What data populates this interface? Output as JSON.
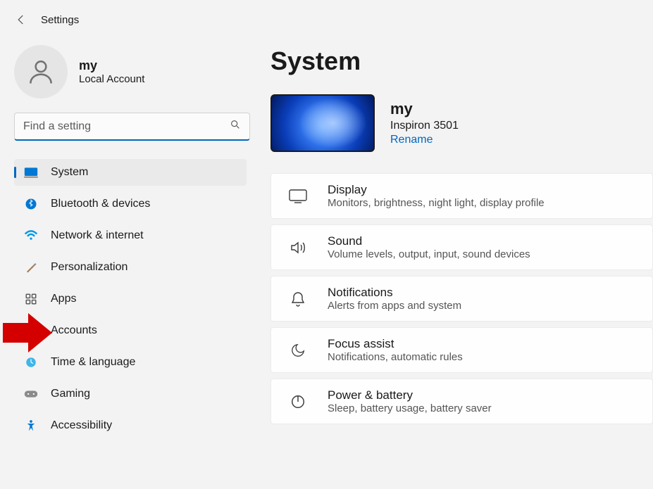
{
  "header": {
    "title": "Settings"
  },
  "account": {
    "name": "my",
    "type": "Local Account"
  },
  "search": {
    "placeholder": "Find a setting"
  },
  "nav": [
    {
      "id": "system",
      "label": "System",
      "active": true
    },
    {
      "id": "bluetooth",
      "label": "Bluetooth & devices"
    },
    {
      "id": "network",
      "label": "Network & internet"
    },
    {
      "id": "personalization",
      "label": "Personalization"
    },
    {
      "id": "apps",
      "label": "Apps"
    },
    {
      "id": "accounts",
      "label": "Accounts"
    },
    {
      "id": "time",
      "label": "Time & language"
    },
    {
      "id": "gaming",
      "label": "Gaming"
    },
    {
      "id": "accessibility",
      "label": "Accessibility"
    }
  ],
  "page": {
    "title": "System",
    "pc_name": "my",
    "pc_model": "Inspiron 3501",
    "rename_label": "Rename"
  },
  "cards": [
    {
      "id": "display",
      "title": "Display",
      "desc": "Monitors, brightness, night light, display profile"
    },
    {
      "id": "sound",
      "title": "Sound",
      "desc": "Volume levels, output, input, sound devices"
    },
    {
      "id": "notifications",
      "title": "Notifications",
      "desc": "Alerts from apps and system"
    },
    {
      "id": "focus",
      "title": "Focus assist",
      "desc": "Notifications, automatic rules"
    },
    {
      "id": "power",
      "title": "Power & battery",
      "desc": "Sleep, battery usage, battery saver"
    }
  ],
  "annotation": {
    "points_to": "apps"
  }
}
